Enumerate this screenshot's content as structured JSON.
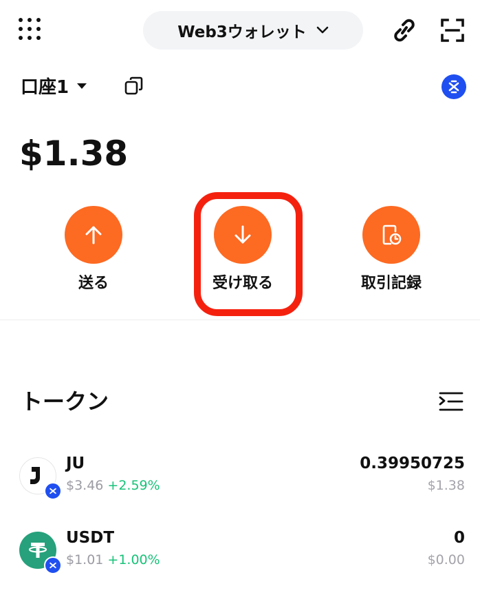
{
  "header": {
    "wallet_selector": "Web3ウォレット"
  },
  "account": {
    "name": "口座1"
  },
  "balance": "$1.38",
  "actions": {
    "send": "送る",
    "receive": "受け取る",
    "history": "取引記録"
  },
  "tokens_section": {
    "title": "トークン",
    "items": [
      {
        "symbol": "JU",
        "price": "$3.46",
        "change": "+2.59%",
        "amount": "0.39950725",
        "value": "$1.38"
      },
      {
        "symbol": "USDT",
        "price": "$1.01",
        "change": "+1.00%",
        "amount": "0",
        "value": "$0.00"
      }
    ]
  },
  "colors": {
    "accent": "#fd6a22",
    "highlight": "#f5210f",
    "network": "#1f4ff0",
    "positive": "#17c279",
    "usdt": "#26a17b"
  },
  "icons": {
    "menu": "grid-menu-icon",
    "dropdown": "chevron-down-icon",
    "link": "link-icon",
    "scan": "scan-icon",
    "copy": "copy-icon",
    "network": "network-badge-icon",
    "send": "arrow-up-icon",
    "receive": "arrow-down-icon",
    "history": "history-icon",
    "filter": "filter-list-icon"
  }
}
